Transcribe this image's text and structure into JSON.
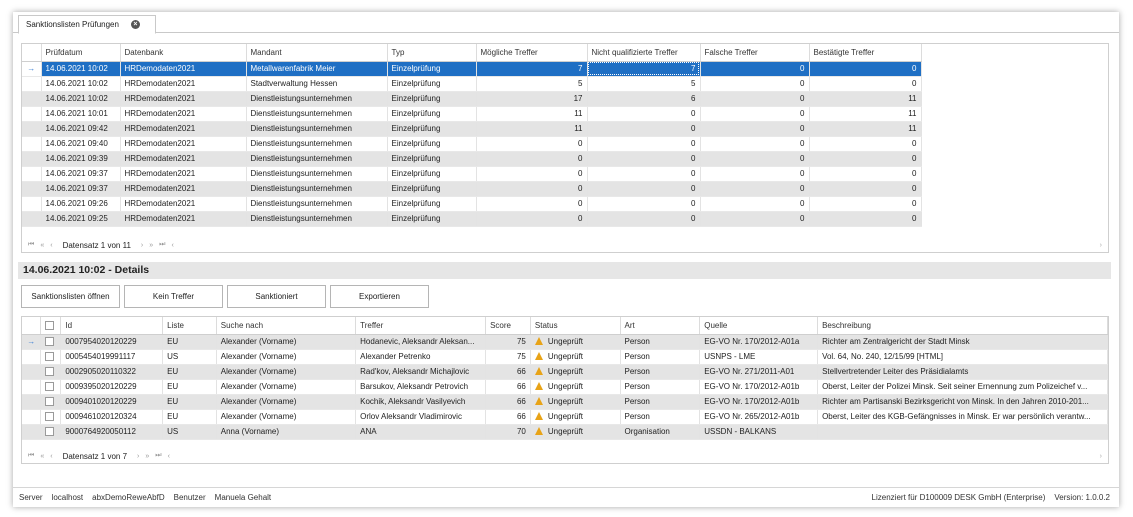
{
  "tab": {
    "title": "Sanktionslisten Prüfungen",
    "close_icon": "×"
  },
  "top_grid": {
    "columns": [
      "Prüfdatum",
      "Datenbank",
      "Mandant",
      "Typ",
      "Mögliche Treffer",
      "Nicht qualifizierte Treffer",
      "Falsche Treffer",
      "Bestätigte Treffer"
    ],
    "rows": [
      [
        "14.06.2021 10:02",
        "HRDemodaten2021",
        "Metallwarenfabrik Meier",
        "Einzelprüfung",
        "7",
        "7",
        "0",
        "0"
      ],
      [
        "14.06.2021 10:02",
        "HRDemodaten2021",
        "Stadtverwaltung Hessen",
        "Einzelprüfung",
        "5",
        "5",
        "0",
        "0"
      ],
      [
        "14.06.2021 10:02",
        "HRDemodaten2021",
        "Dienstleistungsunternehmen",
        "Einzelprüfung",
        "17",
        "6",
        "0",
        "11"
      ],
      [
        "14.06.2021 10:01",
        "HRDemodaten2021",
        "Dienstleistungsunternehmen",
        "Einzelprüfung",
        "11",
        "0",
        "0",
        "11"
      ],
      [
        "14.06.2021 09:42",
        "HRDemodaten2021",
        "Dienstleistungsunternehmen",
        "Einzelprüfung",
        "11",
        "0",
        "0",
        "11"
      ],
      [
        "14.06.2021 09:40",
        "HRDemodaten2021",
        "Dienstleistungsunternehmen",
        "Einzelprüfung",
        "0",
        "0",
        "0",
        "0"
      ],
      [
        "14.06.2021 09:39",
        "HRDemodaten2021",
        "Dienstleistungsunternehmen",
        "Einzelprüfung",
        "0",
        "0",
        "0",
        "0"
      ],
      [
        "14.06.2021 09:37",
        "HRDemodaten2021",
        "Dienstleistungsunternehmen",
        "Einzelprüfung",
        "0",
        "0",
        "0",
        "0"
      ],
      [
        "14.06.2021 09:37",
        "HRDemodaten2021",
        "Dienstleistungsunternehmen",
        "Einzelprüfung",
        "0",
        "0",
        "0",
        "0"
      ],
      [
        "14.06.2021 09:26",
        "HRDemodaten2021",
        "Dienstleistungsunternehmen",
        "Einzelprüfung",
        "0",
        "0",
        "0",
        "0"
      ],
      [
        "14.06.2021 09:25",
        "HRDemodaten2021",
        "Dienstleistungsunternehmen",
        "Einzelprüfung",
        "0",
        "0",
        "0",
        "0"
      ]
    ],
    "navigator": {
      "record_text": "Datensatz 1 von 11"
    }
  },
  "details": {
    "title": "14.06.2021 10:02 - Details",
    "buttons": {
      "open": "Sanktionslisten öffnen",
      "no_hit": "Kein Treffer",
      "sanctioned": "Sanktioniert",
      "export": "Exportieren"
    },
    "columns": [
      "Id",
      "Liste",
      "Suche nach",
      "Treffer",
      "Score",
      "Status",
      "Art",
      "Quelle",
      "Beschreibung"
    ],
    "rows": [
      [
        "0007954020120229",
        "EU",
        "Alexander (Vorname)",
        "Hodanevic, Aleksandr Aleksan...",
        "75",
        "Ungeprüft",
        "Person",
        "EG-VO Nr. 170/2012-A01a",
        "Richter am Zentralgericht der Stadt Minsk"
      ],
      [
        "0005454019991117",
        "US",
        "Alexander (Vorname)",
        "Alexander Petrenko",
        "75",
        "Ungeprüft",
        "Person",
        "USNPS - LME",
        "Vol. 64, No. 240, 12/15/99 [HTML]"
      ],
      [
        "0002905020110322",
        "EU",
        "Alexander (Vorname)",
        "Rad'kov, Aleksandr Michajlovic",
        "66",
        "Ungeprüft",
        "Person",
        "EG-VO Nr. 271/2011-A01",
        "Stellvertretender Leiter des Präsidialamts"
      ],
      [
        "0009395020120229",
        "EU",
        "Alexander (Vorname)",
        "Barsukov, Aleksandr Petrovich",
        "66",
        "Ungeprüft",
        "Person",
        "EG-VO Nr. 170/2012-A01b",
        "Oberst, Leiter der Polizei Minsk. Seit seiner Ernennung zum Polizeichef v..."
      ],
      [
        "0009401020120229",
        "EU",
        "Alexander (Vorname)",
        "Kochik, Aleksandr Vasilyevich",
        "66",
        "Ungeprüft",
        "Person",
        "EG-VO Nr. 170/2012-A01b",
        "Richter am Partisanski Bezirksgericht von Minsk. In den Jahren 2010-201..."
      ],
      [
        "0009461020120324",
        "EU",
        "Alexander (Vorname)",
        "Orlov Aleksandr Vladimirovic",
        "66",
        "Ungeprüft",
        "Person",
        "EG-VO Nr. 265/2012-A01b",
        "Oberst, Leiter des KGB-Gefängnisses in Minsk. Er war persönlich verantw..."
      ],
      [
        "9000764920050112",
        "US",
        "Anna (Vorname)",
        "ANA",
        "70",
        "Ungeprüft",
        "Organisation",
        "USSDN - BALKANS",
        ""
      ]
    ],
    "navigator": {
      "record_text": "Datensatz 1 von 7"
    }
  },
  "statusbar": {
    "server_label": "Server",
    "server_value": "localhost",
    "db_value": "abxDemoReweAbfD",
    "user_label": "Benutzer",
    "user_value": "Manuela Gehalt",
    "license": "Lizenziert für D100009 DESK GmbH (Enterprise)",
    "version": "Version: 1.0.0.2"
  },
  "icons": {
    "row_indicator": "→",
    "nav_first": "⏮",
    "nav_prev_page": "«",
    "nav_prev": "‹",
    "nav_next": "›",
    "nav_next_page": "»",
    "nav_last": "⏭",
    "nav_more": "‹",
    "scroll": "›"
  },
  "colors": {
    "selection": "#1f6fc4",
    "alt_row": "#e4e4e4",
    "warning": "#e8a317"
  }
}
